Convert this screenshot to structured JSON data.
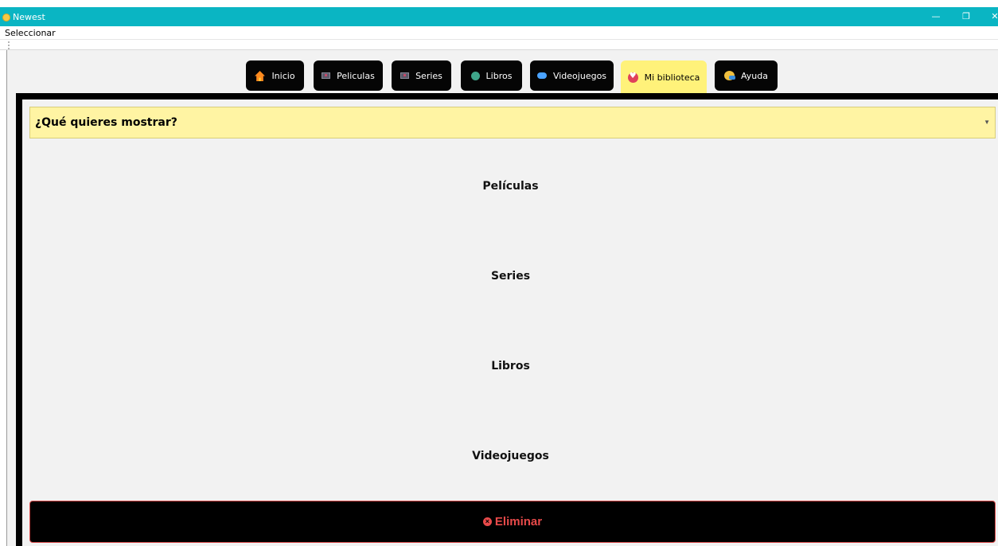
{
  "window": {
    "title": "Newest",
    "minimize_glyph": "—",
    "restore_glyph": "❐",
    "close_glyph": "✕"
  },
  "menu": {
    "item": "Seleccionar"
  },
  "nav": {
    "items": [
      {
        "label": "Inicio",
        "icon": "house-icon"
      },
      {
        "label": "Peliculas",
        "icon": "film-icon"
      },
      {
        "label": "Series",
        "icon": "tv-icon"
      },
      {
        "label": "Libros",
        "icon": "book-icon"
      },
      {
        "label": "Videojuegos",
        "icon": "gamepad-icon"
      },
      {
        "label": "Mi biblioteca",
        "icon": "heart-icon"
      },
      {
        "label": "Ayuda",
        "icon": "help-icon"
      }
    ],
    "active": "Mi biblioteca"
  },
  "combo": {
    "label": "¿Qué quieres mostrar?"
  },
  "categories": [
    "Películas",
    "Series",
    "Libros",
    "Videojuegos"
  ],
  "delete": {
    "label": "Eliminar",
    "icon": "close-circle-icon"
  },
  "colors": {
    "titlebar": "#0ab5c3",
    "active_tab": "#fff27a",
    "combo_bg": "#fff4a3",
    "delete_text": "#e84a4a"
  }
}
